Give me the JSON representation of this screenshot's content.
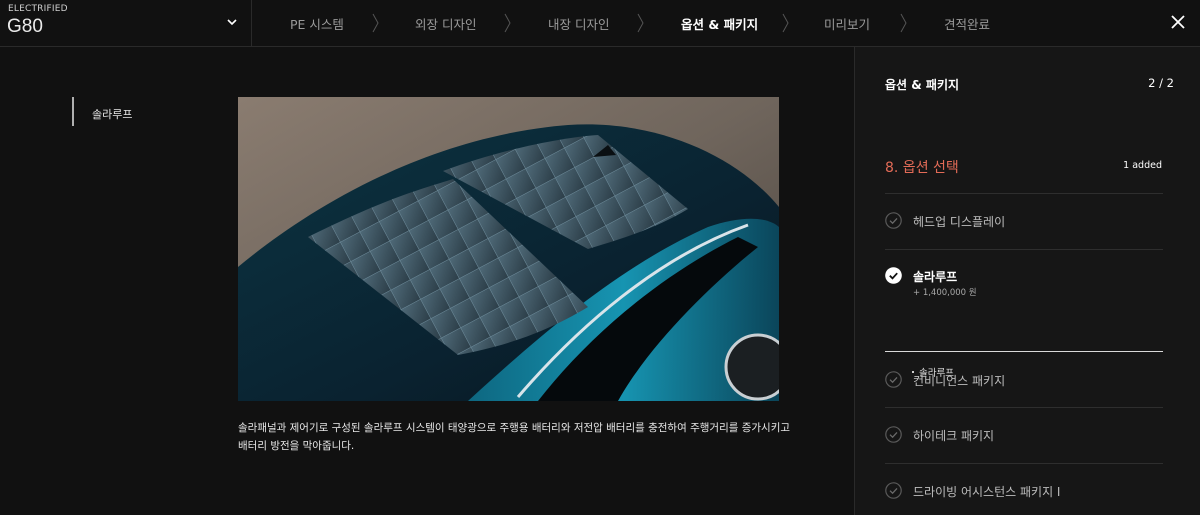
{
  "header": {
    "model_sub": "ELECTRIFIED",
    "model_name": "G80",
    "steps": [
      {
        "label": "PE 시스템",
        "active": false
      },
      {
        "label": "외장 디자인",
        "active": false
      },
      {
        "label": "내장 디자인",
        "active": false
      },
      {
        "label": "옵션 & 패키지",
        "active": true
      },
      {
        "label": "미리보기",
        "active": false
      },
      {
        "label": "견적완료",
        "active": false
      }
    ]
  },
  "left_nav": {
    "label": "솔라루프"
  },
  "main": {
    "description_line1": "솔라패널과 제어기로 구성된 솔라루프 시스템이 태양광으로 주행용 배터리와 저전압 배터리를 충전하여 주행거리를 증가시키고",
    "description_line2": "배터리 방전을 막아줍니다."
  },
  "panel": {
    "title": "옵션 & 패키지",
    "page": "2 / 2",
    "section_title": "8. 옵션 선택",
    "section_count": "1 added",
    "options": [
      {
        "label": "헤드업 디스플레이",
        "selected": false
      },
      {
        "label": "솔라루프",
        "selected": true,
        "price": "+ 1,400,000 원",
        "sub_item": "솔라루프"
      },
      {
        "label": "컨비니언스 패키지",
        "selected": false
      },
      {
        "label": "하이테크 패키지",
        "selected": false
      },
      {
        "label": "드라이빙 어시스턴스 패키지 I",
        "selected": false
      }
    ]
  },
  "colors": {
    "background": "#111111",
    "panel": "#161616",
    "accent": "#e36b57",
    "text": "#ffffff"
  }
}
